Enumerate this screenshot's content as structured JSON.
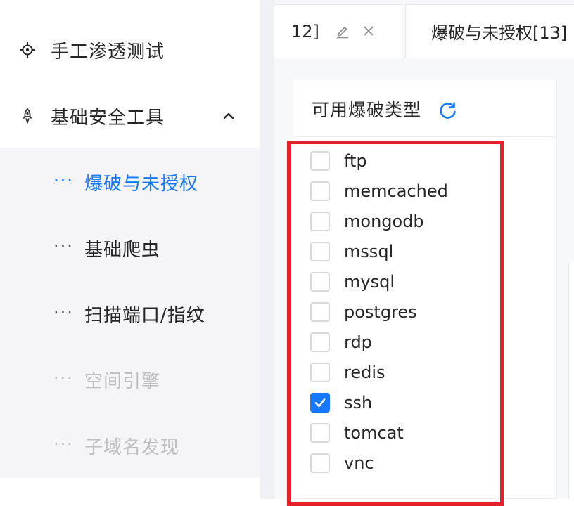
{
  "sidebar": {
    "items": [
      {
        "label": "手工渗透测试",
        "icon": "crosshair-icon"
      },
      {
        "label": "基础安全工具",
        "icon": "rocket-icon",
        "expanded": true,
        "arrow": "chevron-up-icon"
      }
    ],
    "submenu": [
      {
        "dots": "···",
        "label": "爆破与未授权",
        "state": "active"
      },
      {
        "dots": "···",
        "label": "基础爬虫",
        "state": "normal"
      },
      {
        "dots": "···",
        "label": "扫描端口/指纹",
        "state": "normal"
      },
      {
        "dots": "···",
        "label": "空间引擎",
        "state": "disabled"
      },
      {
        "dots": "···",
        "label": "子域名发现",
        "state": "disabled"
      }
    ]
  },
  "tabs": [
    {
      "label": "12]",
      "icons": [
        "edit-icon",
        "close-icon"
      ]
    },
    {
      "label": "爆破与未授权[13]"
    }
  ],
  "panel": {
    "title": "可用爆破类型",
    "refresh_icon": "refresh-icon",
    "options": [
      {
        "label": "ftp",
        "checked": false
      },
      {
        "label": "memcached",
        "checked": false
      },
      {
        "label": "mongodb",
        "checked": false
      },
      {
        "label": "mssql",
        "checked": false
      },
      {
        "label": "mysql",
        "checked": false
      },
      {
        "label": "postgres",
        "checked": false
      },
      {
        "label": "rdp",
        "checked": false
      },
      {
        "label": "redis",
        "checked": false
      },
      {
        "label": "ssh",
        "checked": true
      },
      {
        "label": "tomcat",
        "checked": false
      },
      {
        "label": "vnc",
        "checked": false
      }
    ]
  },
  "colors": {
    "accent": "#1677ff",
    "highlight": "#e8202a",
    "disabled_text": "#bfbfbf",
    "submenu_bg": "#f5f5f7"
  }
}
